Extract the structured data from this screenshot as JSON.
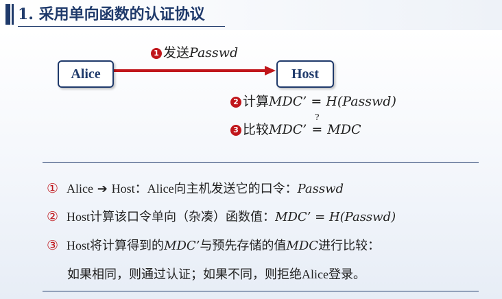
{
  "title": "1. 采用单向函数的认证协议",
  "diagram": {
    "alice": "Alice",
    "host": "Host",
    "steps": [
      {
        "num": "1",
        "label": "发送",
        "math": "Passwd"
      },
      {
        "num": "2",
        "label": "计算",
        "math": "MDC’ = H(Passwd)"
      },
      {
        "num": "3",
        "label": "比较",
        "lhs": "MDC’",
        "op": "=",
        "op_mark": "?",
        "rhs": "MDC"
      }
    ]
  },
  "notes": [
    {
      "marker": "①",
      "a": "Alice",
      "arrow": "➔",
      "b": "Host：Alice向主机发送它的口令：",
      "math": "Passwd"
    },
    {
      "marker": "②",
      "a": "Host计算该口令单向（杂凑）函数值：",
      "math": "MDC’ = H(Passwd)"
    },
    {
      "marker": "③",
      "a": "Host将计算得到的",
      "math1": "MDC’",
      "b": "与预先存储的值",
      "math2": "MDC",
      "c": "进行比较："
    },
    {
      "text": "如果相同，则通过认证；如果不同，则拒绝Alice登录。"
    }
  ],
  "colors": {
    "accent": "#1f3a6b",
    "arrow": "#c0161b"
  }
}
